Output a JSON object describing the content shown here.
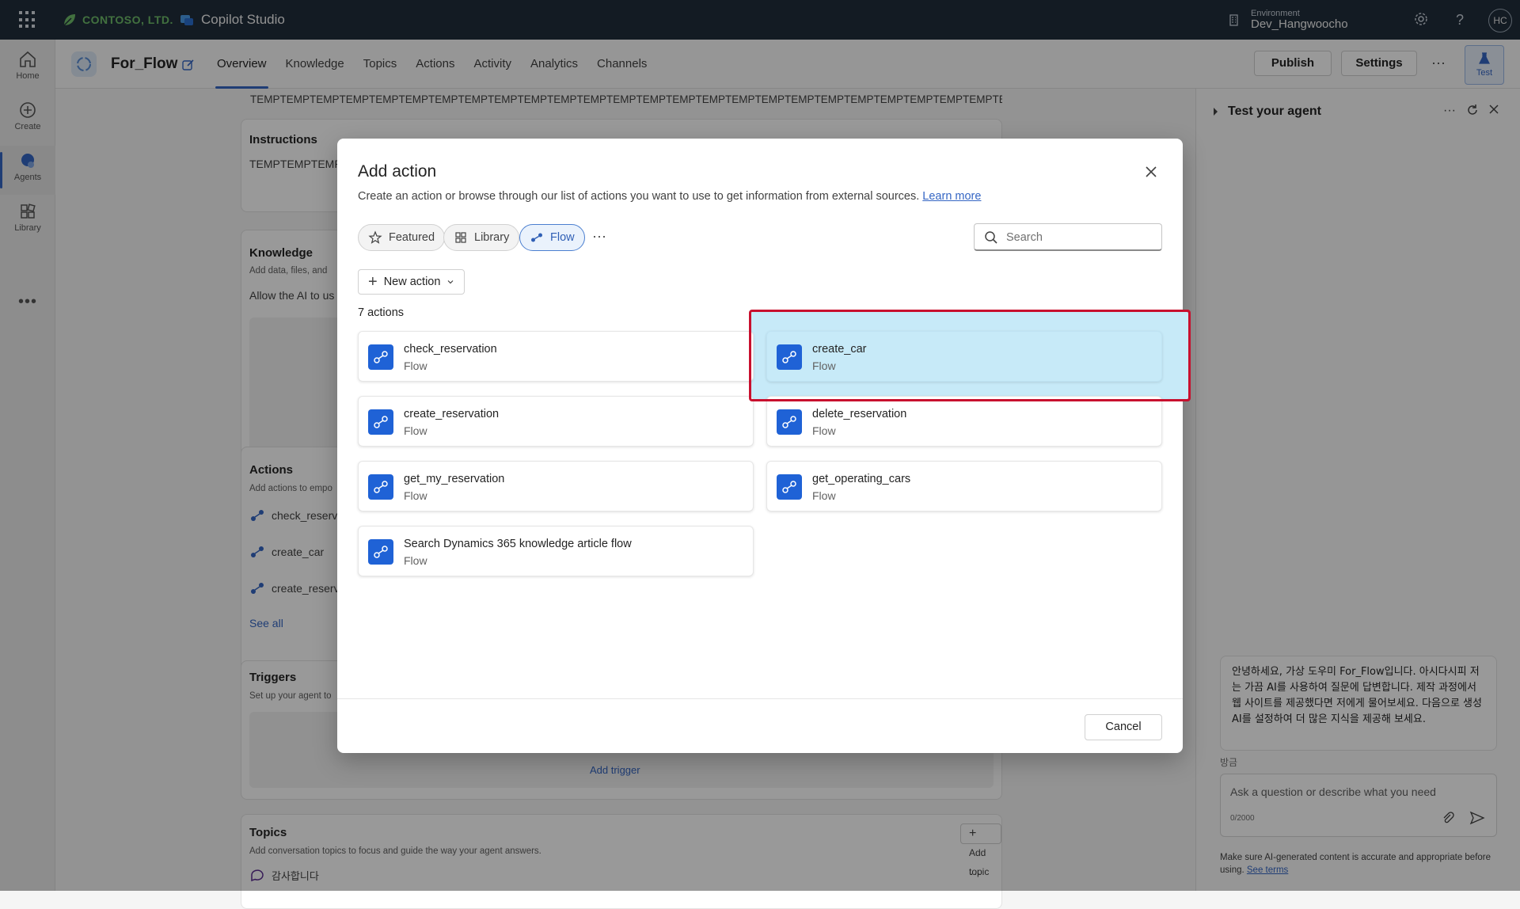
{
  "topbar": {
    "company": "CONTOSO, LTD.",
    "product": "Copilot Studio",
    "environment_label": "Environment",
    "environment_name": "Dev_Hangwoocho",
    "user_initials": "HC"
  },
  "rail": {
    "items": [
      {
        "label": "Home",
        "icon": "home-icon"
      },
      {
        "label": "Create",
        "icon": "plus-circle-icon"
      },
      {
        "label": "Agents",
        "icon": "agents-icon"
      },
      {
        "label": "Library",
        "icon": "library-icon"
      }
    ],
    "more": "•••"
  },
  "header": {
    "agent_name": "For_Flow",
    "tabs": [
      "Overview",
      "Knowledge",
      "Topics",
      "Actions",
      "Activity",
      "Analytics",
      "Channels"
    ],
    "active_tab": "Overview",
    "publish_label": "Publish",
    "settings_label": "Settings",
    "more_label": "···",
    "test_label": "Test"
  },
  "background": {
    "temp_text": "TEMPTEMPTEMPTEMPTEMPTEMPTEMPTEMPTEMPTEMPTEMPTEMPTEMPTEMPTEMPTEMPTEMPTEMPTEMPTEMPTEMPTEMPTEMPTEMPTEMPTEMPTEMPTEMPTEMPTEMPTEMPTEMPTEMPTEMPTEMPTEMPTEMPTEMPTEMPTEMPTEMPTEMPTEMPTEMPTEMPTEMPTEMPTEMPTEMP",
    "instructions_title": "Instructions",
    "instructions_text": "TEMPTEMPTEMPTEMP",
    "knowledge_title": "Knowledge",
    "knowledge_desc": "Add data, files, and",
    "knowledge_text": "Allow the AI to us",
    "actions_title": "Actions",
    "actions_desc": "Add actions to empo",
    "actions_items": [
      "check_reserv",
      "create_car",
      "create_reserv"
    ],
    "see_all": "See all",
    "triggers_title": "Triggers",
    "triggers_desc": "Set up your agent to",
    "add_trigger": "Add trigger",
    "topics_title": "Topics",
    "topics_desc": "Add conversation topics to focus and guide the way your agent answers.",
    "add_topic": "Add topic",
    "topic_item": "감사합니다",
    "topic_more": "···"
  },
  "test_panel": {
    "title": "Test your agent",
    "welcome": "안녕하세요, 가상 도우미 For_Flow입니다. 아시다시피 저는 가끔 AI를 사용하여 질문에 답변합니다. 제작 과정에서 웹 사이트를 제공했다면 저에게 물어보세요. 다음으로 생성 AI를 설정하여 더 많은 지식을 제공해 보세요.",
    "timestamp": "방금",
    "input_placeholder": "Ask a question or describe what you need",
    "char_count": "0/2000",
    "disclaimer": "Make sure AI-generated content is accurate and appropriate before using.",
    "see_terms": "See terms"
  },
  "modal": {
    "title": "Add action",
    "description": "Create an action or browse through our list of actions you want to use to get information from external sources.",
    "learn_more": "Learn more",
    "filters": [
      {
        "label": "Featured",
        "icon": "star-icon"
      },
      {
        "label": "Library",
        "icon": "library-icon"
      },
      {
        "label": "Flow",
        "icon": "flow-icon"
      }
    ],
    "active_filter": "Flow",
    "more_label": "···",
    "search_placeholder": "Search",
    "new_action_label": "New action",
    "count_label": "7 actions",
    "actions": [
      {
        "name": "check_reservation",
        "type": "Flow"
      },
      {
        "name": "create_car",
        "type": "Flow"
      },
      {
        "name": "create_reservation",
        "type": "Flow"
      },
      {
        "name": "delete_reservation",
        "type": "Flow"
      },
      {
        "name": "get_my_reservation",
        "type": "Flow"
      },
      {
        "name": "get_operating_cars",
        "type": "Flow"
      },
      {
        "name": "Search Dynamics 365 knowledge article flow",
        "type": "Flow"
      }
    ],
    "selected_action": "create_car",
    "cancel_label": "Cancel"
  },
  "colors": {
    "topbar": "#202d3b",
    "accent": "#3566c4",
    "flow_icon": "#1f62d6",
    "selected_fill": "#c7eaf8",
    "highlight_border": "#c8102e"
  }
}
